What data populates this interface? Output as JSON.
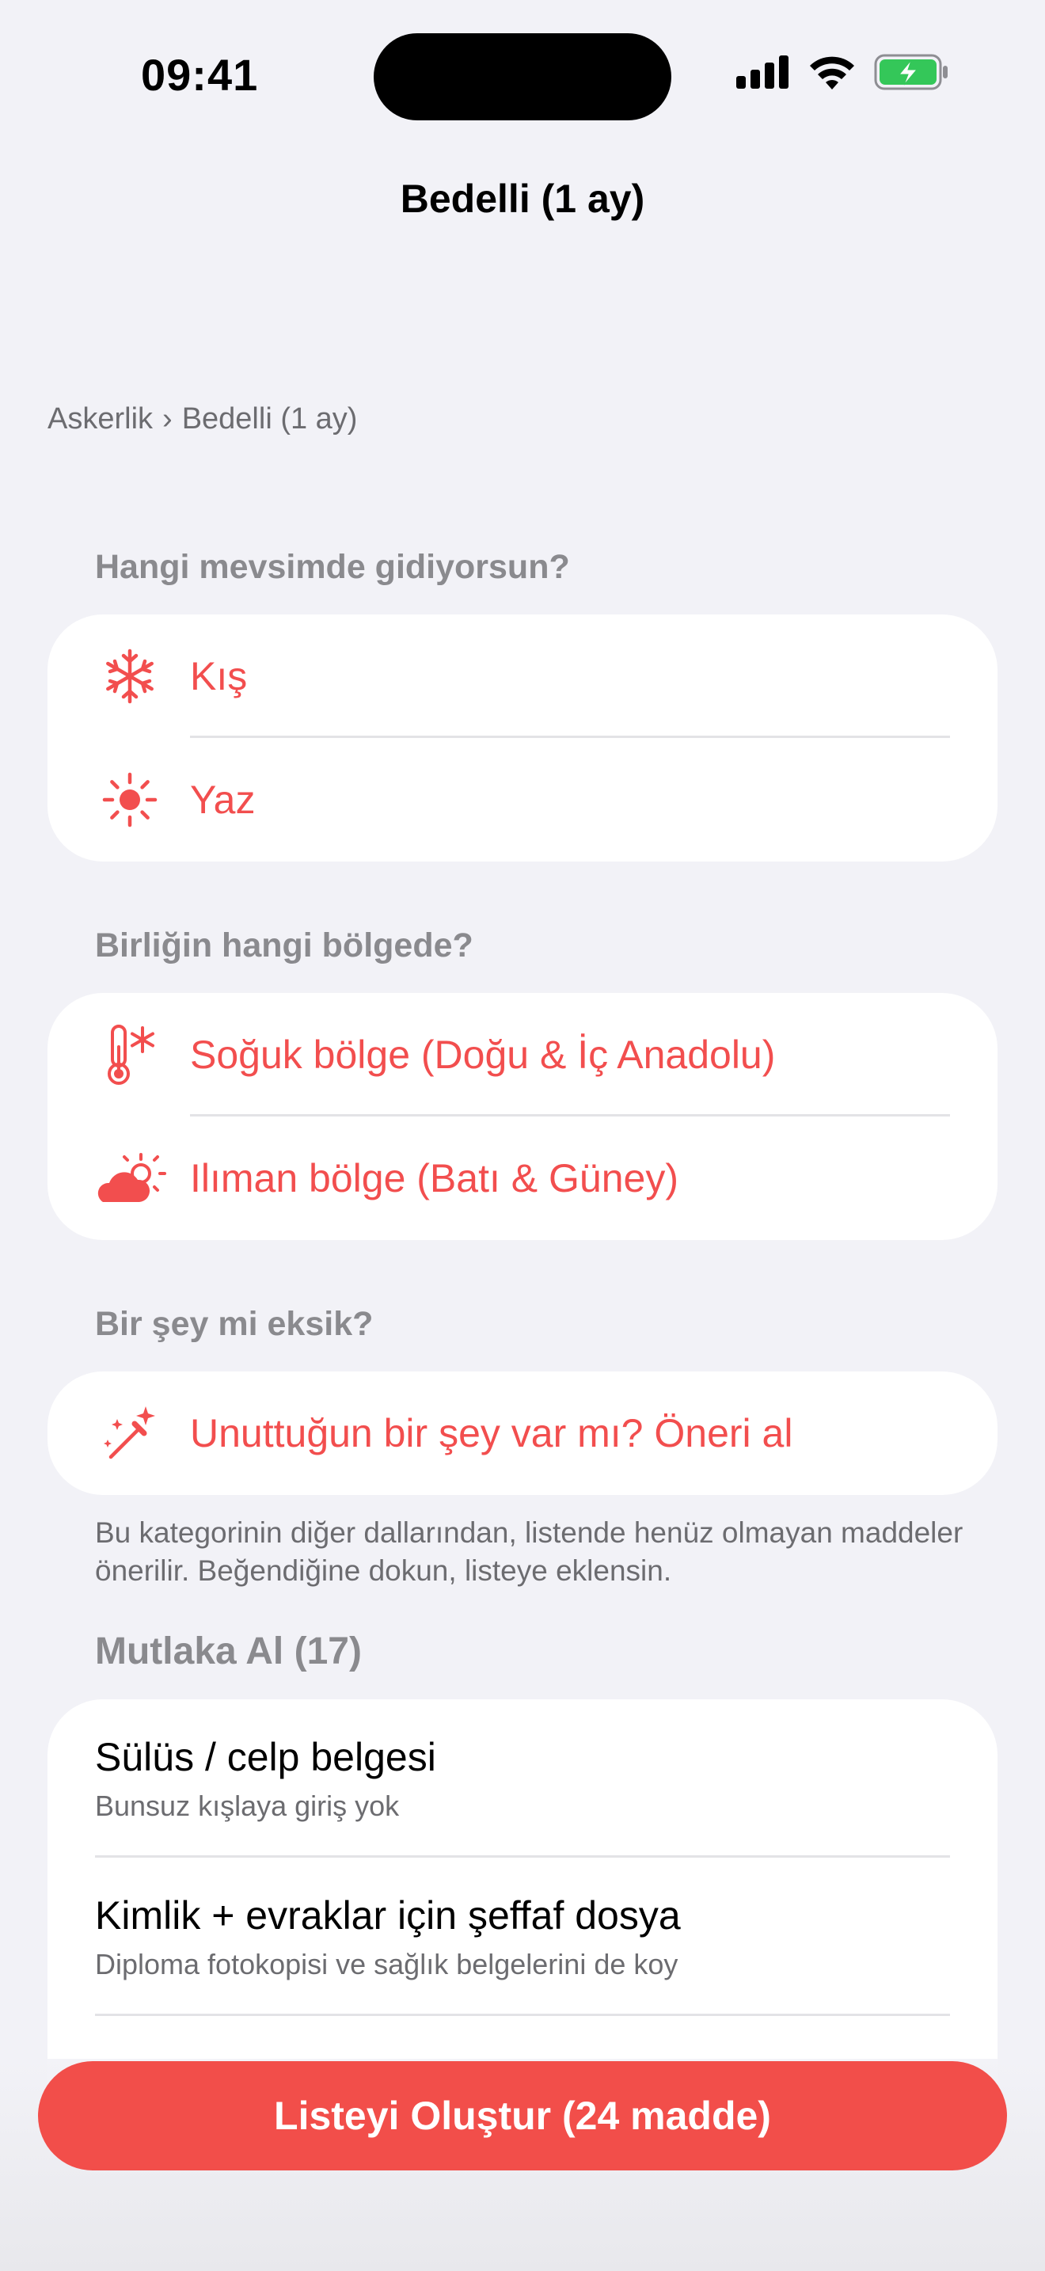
{
  "status_bar": {
    "time": "09:41"
  },
  "nav": {
    "title": "Bedelli (1 ay)"
  },
  "breadcrumb": {
    "items": [
      "Askerlik",
      "Bedelli (1 ay)"
    ],
    "separator": "›"
  },
  "season": {
    "header": "Hangi mevsimde gidiyorsun?",
    "options": [
      {
        "label": "Kış",
        "icon": "snowflake-icon"
      },
      {
        "label": "Yaz",
        "icon": "sun-icon"
      }
    ]
  },
  "region": {
    "header": "Birliğin hangi bölgede?",
    "options": [
      {
        "label": "Soğuk bölge (Doğu & İç Anadolu)",
        "icon": "thermometer-snowflake-icon"
      },
      {
        "label": "Ilıman bölge (Batı & Güney)",
        "icon": "sun-behind-cloud-icon"
      }
    ]
  },
  "suggest": {
    "header": "Bir şey mi eksik?",
    "button_label": "Unuttuğun bir şey var mı? Öneri al",
    "icon": "magic-wand-icon",
    "footnote": "Bu kategorinin diğer dallarından, listende henüz olmayan maddeler önerilir. Beğendiğine dokun, listeye eklensin."
  },
  "must_take": {
    "header": "Mutlaka Al (17)",
    "items": [
      {
        "title": "Sülüs / celp belgesi",
        "subtitle": "Bunsuz kışlaya giriş yok"
      },
      {
        "title": "Kimlik + evraklar için şeffaf dosya",
        "subtitle": "Diploma fotokopisi ve sağlık belgelerini de koy"
      }
    ]
  },
  "cta": {
    "label": "Listeyi Oluştur (24 madde)"
  },
  "colors": {
    "accent": "#f24e4e",
    "background": "#f2f2f7",
    "battery": "#34c759"
  }
}
